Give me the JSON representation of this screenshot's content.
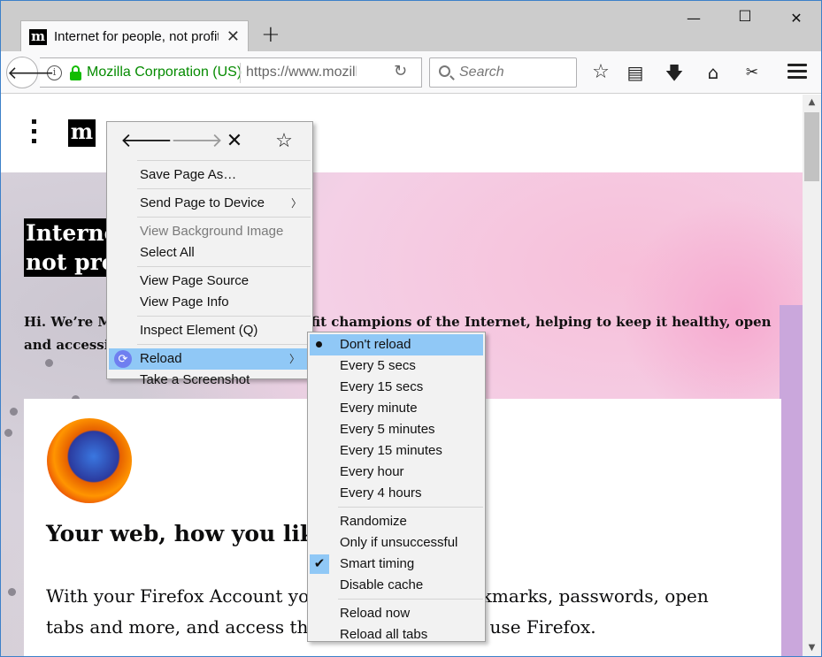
{
  "tab": {
    "favicon": "m",
    "title": "Internet for people, not profit — Mozilla",
    "close": "✕"
  },
  "newtab": "+",
  "window_controls": {
    "minimize": "—",
    "maximize": "☐",
    "close": "✕"
  },
  "navbar": {
    "identity": "Mozilla Corporation (US)",
    "url": "https://www.mozilla.org/en-US/",
    "search_placeholder": "Search"
  },
  "page": {
    "logo": "m",
    "headline_line1": "Internet for people,",
    "headline_line2": "not profit",
    "intro": "Hi. We’re Mozilla, the proudly non-profit champions of the Internet, helping to keep it healthy, open and accessible to all.",
    "card_heading": "Your web, how you like it",
    "card_text": "With your Firefox Account you get access to bookmarks, passwords, open tabs and more, and access them everywhere you use Firefox."
  },
  "context_menu": {
    "nav": {
      "back": "🡐",
      "forward": "🡒",
      "stop": "✕",
      "bookmark": "☆"
    },
    "items": [
      "Save Page As…",
      "Send Page to Device",
      "View Background Image",
      "Select All",
      "View Page Source",
      "View Page Info",
      "Inspect Element (Q)",
      "Reload",
      "Take a Screenshot"
    ]
  },
  "reload_submenu": {
    "intervals": [
      "Don't reload",
      "Every 5 secs",
      "Every 15 secs",
      "Every minute",
      "Every 5 minutes",
      "Every 15 minutes",
      "Every hour",
      "Every 4 hours"
    ],
    "options": [
      "Randomize",
      "Only if unsuccessful",
      "Smart timing",
      "Disable cache"
    ],
    "actions": [
      "Reload now",
      "Reload all tabs"
    ],
    "selected_interval": "Don't reload",
    "checked_option": "Smart timing"
  },
  "colors": {
    "highlight": "#90c8f6",
    "secure_green": "#12bc00",
    "identity_green": "#058b00"
  }
}
